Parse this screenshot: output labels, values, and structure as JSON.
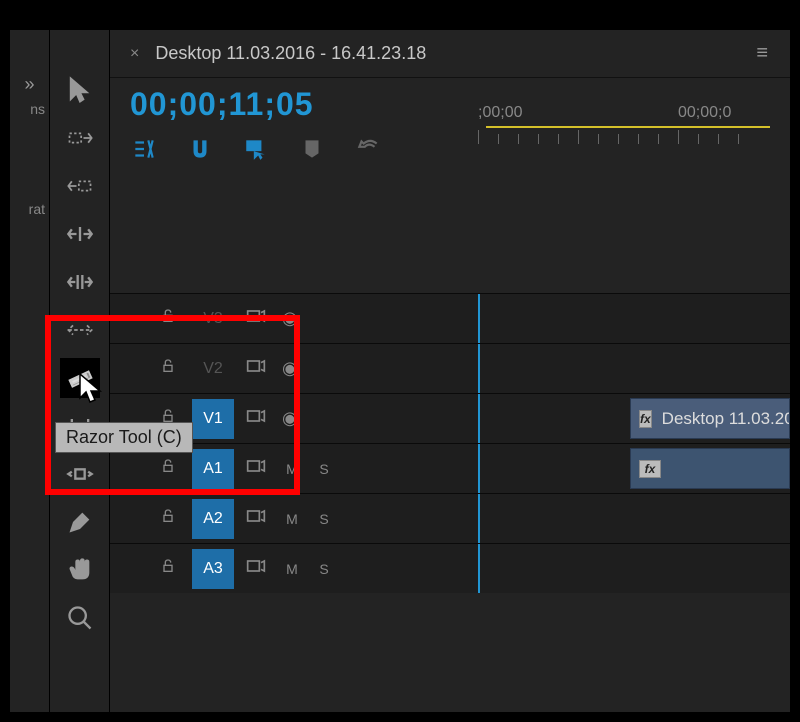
{
  "leftStub": {
    "expand": "»",
    "label1": "ns",
    "label2": "rat"
  },
  "tools": [
    {
      "name": "selection-tool"
    },
    {
      "name": "track-select-forward-tool"
    },
    {
      "name": "track-select-backward-tool"
    },
    {
      "name": "ripple-edit-tool"
    },
    {
      "name": "rolling-edit-tool"
    },
    {
      "name": "rate-stretch-tool"
    },
    {
      "name": "razor-tool"
    },
    {
      "name": "slip-tool"
    },
    {
      "name": "slide-tool"
    },
    {
      "name": "pen-tool"
    },
    {
      "name": "hand-tool"
    },
    {
      "name": "zoom-tool"
    }
  ],
  "tab": {
    "title": "Desktop 11.03.2016 - 16.41.23.18",
    "close": "×",
    "menu": "≡"
  },
  "timecode": "00;00;11;05",
  "ruler": {
    "label1": ";00;00",
    "label2": "00;00;0"
  },
  "timelineTools": {
    "nest": "nest",
    "snap": "snap",
    "linkedSelection": "linked",
    "marker": "marker",
    "settings": "settings"
  },
  "tracks": {
    "video": [
      {
        "label": "V3",
        "style": "grey",
        "eye": true
      },
      {
        "label": "V2",
        "style": "grey",
        "eye": true
      },
      {
        "label": "V1",
        "style": "blue",
        "eye": true
      }
    ],
    "audio": [
      {
        "label": "A1",
        "style": "blue"
      },
      {
        "label": "A2",
        "style": "blue"
      },
      {
        "label": "A3",
        "style": "blue"
      }
    ],
    "letters": {
      "m": "M",
      "s": "S"
    }
  },
  "clips": {
    "video": {
      "fx": "fx",
      "name": "Desktop 11.03.20"
    },
    "audio": {
      "fx": "fx"
    }
  },
  "tooltip": "Razor Tool (C)"
}
